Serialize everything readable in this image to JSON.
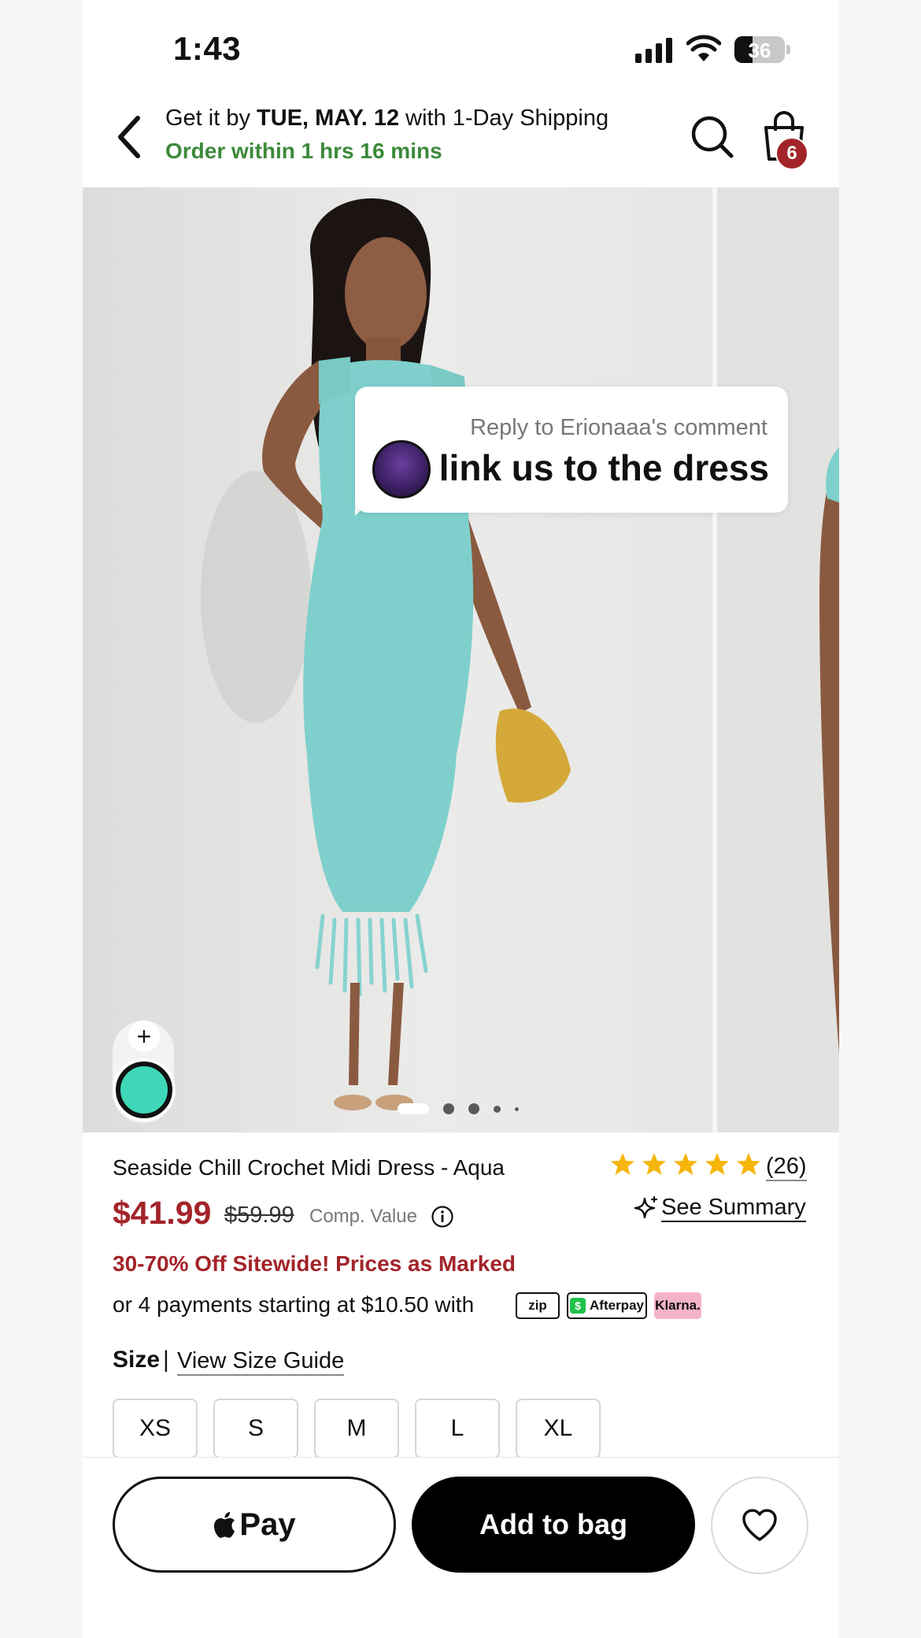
{
  "status_bar": {
    "time": "1:43",
    "battery": "36"
  },
  "header": {
    "ship_prefix": "Get it by ",
    "ship_date": "TUE, MAY. 12",
    "ship_suffix": " with 1-Day Shipping",
    "order_within": "Order within 1 hrs 16 mins",
    "cart_count": "6"
  },
  "overlay": {
    "reply_to": "Reply to Erionaaa's comment",
    "comment": "link us to the dress"
  },
  "gallery": {
    "active_index": 0,
    "dot_count": 5,
    "selected_color": "#3ed8b8"
  },
  "product": {
    "title": "Seaside Chill Crochet Midi Dress - Aqua",
    "rating": 5,
    "review_count": "(26)",
    "price": "$41.99",
    "original_price": "$59.99",
    "comp_value_label": "Comp. Value",
    "see_summary": "See Summary",
    "promo": "30-70% Off Sitewide! Prices as Marked",
    "payments_text": "or 4 payments starting at $10.50 with",
    "payment_logos": {
      "zip": "zip",
      "afterpay": "Afterpay",
      "klarna": "Klarna."
    }
  },
  "size": {
    "label": "Size",
    "separator": "|",
    "guide": "View Size Guide",
    "options": [
      "XS",
      "S",
      "M",
      "L",
      "XL"
    ]
  },
  "bottom_bar": {
    "apple_pay": "Pay",
    "add_to_bag": "Add to bag"
  },
  "colors": {
    "price_red": "#a3242a",
    "shipping_green": "#3c8a3a",
    "star_gold": "#f5b50a"
  }
}
